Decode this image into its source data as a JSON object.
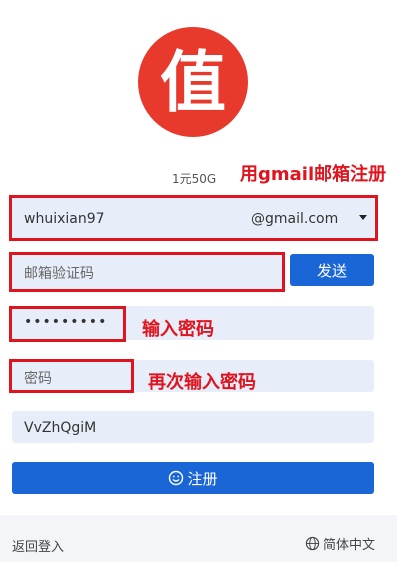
{
  "logo": {
    "char": "值",
    "color": "#e8392d"
  },
  "promo": "1元50G",
  "annotations": {
    "gmail": "用gmail邮箱注册",
    "password": "输入密码",
    "repeat": "再次输入密码"
  },
  "form": {
    "username": "whuixian97",
    "domain": "@gmail.com",
    "dropdown_icon": "caret-down-icon",
    "code_placeholder": "邮箱验证码",
    "send_label": "发送",
    "password_value": "•••••••••",
    "confirm_placeholder": "密码",
    "invite_value": "VvZhQgiM",
    "register_label": "注册",
    "register_icon": "smile-icon"
  },
  "footer": {
    "back_label": "返回登入",
    "language_label": "简体中文",
    "language_icon": "globe-icon"
  },
  "colors": {
    "accent": "#1a66d6",
    "annotation": "#e0141e",
    "field_bg": "#e8eef9"
  }
}
